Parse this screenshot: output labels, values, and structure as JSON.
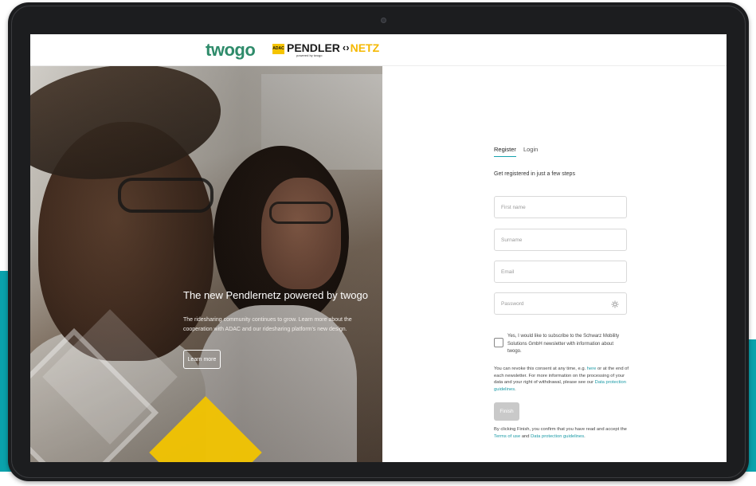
{
  "header": {
    "logo_twogo": "twogo",
    "logo_adac": "ADAC",
    "logo_pendler": "PENDLER",
    "logo_pendler_sub": "powered by twogo",
    "logo_netz": "NETZ"
  },
  "hero": {
    "title": "The new Pendlernetz powered by twogo",
    "text": "The ridesharing community continues to grow. Learn more about the cooperation with ADAC and our ridesharing platform's new design.",
    "button": "Learn more"
  },
  "form": {
    "tabs": [
      {
        "label": "Register",
        "active": true
      },
      {
        "label": "Login",
        "active": false
      }
    ],
    "subtitle": "Get registered in just a few steps",
    "fields": {
      "first_name": {
        "placeholder": "First name",
        "value": ""
      },
      "surname": {
        "placeholder": "Surname",
        "value": ""
      },
      "email": {
        "placeholder": "Email",
        "value": ""
      },
      "password": {
        "placeholder": "Password",
        "value": ""
      }
    },
    "password_toggle_icon": "eye-icon",
    "newsletter": {
      "checked": false,
      "text": "Yes, I would like to subscribe to the Schwarz Mobility Solutions GmbH newsletter with information about twogo."
    },
    "consent": {
      "part1": "You can revoke this consent at any time, e.g.",
      "link_here": "here",
      "part2": "or at the end of each newsletter. For more information on the processing of your data and your right of withdrawal, please see our",
      "link_data_protection": "Data protection guidelines",
      "part3": "."
    },
    "finish_button": "Finish",
    "terms": {
      "part1": "By clicking Finish, you confirm that you have read and accept the",
      "link_terms": "Terms of use",
      "part2": "and",
      "link_data_protection": "Data protection guidelines",
      "part3": "."
    }
  },
  "colors": {
    "accent_teal": "#0aa2ac",
    "logo_green": "#2e8b6a",
    "adac_yellow": "#f5c400",
    "link": "#1a9aa6",
    "button_disabled": "#c9c9c9"
  }
}
